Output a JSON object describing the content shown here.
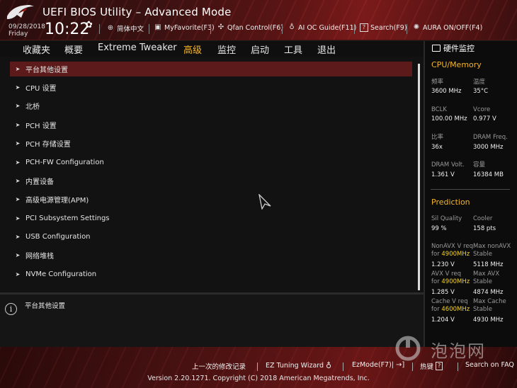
{
  "header": {
    "title": "UEFI BIOS Utility – Advanced Mode",
    "date": "09/28/2018",
    "day": "Friday",
    "time": "10:22",
    "toolbar": [
      {
        "label": "简体中文",
        "icon": "globe-icon"
      },
      {
        "label": "MyFavorite(F3)",
        "icon": "favorite-icon"
      },
      {
        "label": "Qfan Control(F6)",
        "icon": "fan-icon"
      },
      {
        "label": "AI OC Guide(F11)",
        "icon": "lightbulb-icon"
      },
      {
        "label": "Search(F9)",
        "icon": "question-icon"
      },
      {
        "label": "AURA ON/OFF(F4)",
        "icon": "aura-icon"
      }
    ]
  },
  "nav": {
    "tabs": [
      "收藏夹",
      "概要",
      "Extreme Tweaker",
      "高级",
      "监控",
      "启动",
      "工具",
      "退出"
    ],
    "active": "高级"
  },
  "menu": {
    "items": [
      "平台其他设置",
      "CPU 设置",
      "北桥",
      "PCH 设置",
      "PCH 存储设置",
      "PCH-FW Configuration",
      "内置设备",
      "高级电源管理(APM)",
      "PCI Subsystem Settings",
      "USB Configuration",
      "网络堆栈",
      "NVMe Configuration"
    ],
    "selected_index": 0
  },
  "info": {
    "text": "平台其他设置"
  },
  "panel": {
    "title": "硬件监控",
    "cpu_section": "CPU/Memory",
    "cpu": {
      "freq_label": "频率",
      "freq_value": "3600 MHz",
      "temp_label": "温度",
      "temp_value": "35°C",
      "bclk_label": "BCLK",
      "bclk_value": "100.00 MHz",
      "vcore_label": "Vcore",
      "vcore_value": "0.977 V",
      "ratio_label": "比率",
      "ratio_value": "36x",
      "dram_freq_label": "DRAM Freq.",
      "dram_freq_value": "3000 MHz",
      "dram_volt_label": "DRAM Volt.",
      "dram_volt_value": "1.361 V",
      "capacity_label": "容量",
      "capacity_value": "16384 MB"
    },
    "prediction_section": "Prediction",
    "prediction": {
      "sil_label": "Sil Quality",
      "sil_value": "99 %",
      "cooler_label": "Cooler",
      "cooler_value": "158 pts",
      "nonavx_label": "NonAVX V req",
      "nonavx_for": "for",
      "nonavx_freq": "4900MHz",
      "nonavx_value": "1.230 V",
      "max_nonavx_label": "Max nonAVX",
      "max_nonavx_stable": "Stable",
      "max_nonavx_value": "5118 MHz",
      "avx_label": "AVX V req",
      "avx_for": "for",
      "avx_freq": "4900MHz",
      "avx_value": "1.285 V",
      "max_avx_label": "Max AVX",
      "max_avx_stable": "Stable",
      "max_avx_value": "4874 MHz",
      "cache_label": "Cache V req",
      "cache_for": "for",
      "cache_freq": "4600MHz",
      "cache_value": "1.204 V",
      "max_cache_label": "Max Cache",
      "max_cache_stable": "Stable",
      "max_cache_value": "4930 MHz"
    }
  },
  "footer": {
    "last_changes": "上一次的修改记录",
    "ez_tuning": "EZ Tuning Wizard",
    "ezmode": "EzMode(F7)|",
    "hotkeys": "热键",
    "hotkeys_key": "?",
    "search_faq": "Search on FAQ",
    "copyright": "Version 2.20.1271. Copyright (C) 2018 American Megatrends, Inc."
  },
  "watermark": {
    "text": "泡泡网"
  },
  "colors": {
    "accent": "#f5b52a",
    "highlight": "#f5d22a",
    "selection": "#5d1a1a",
    "header_red": "#7a1a1a"
  }
}
